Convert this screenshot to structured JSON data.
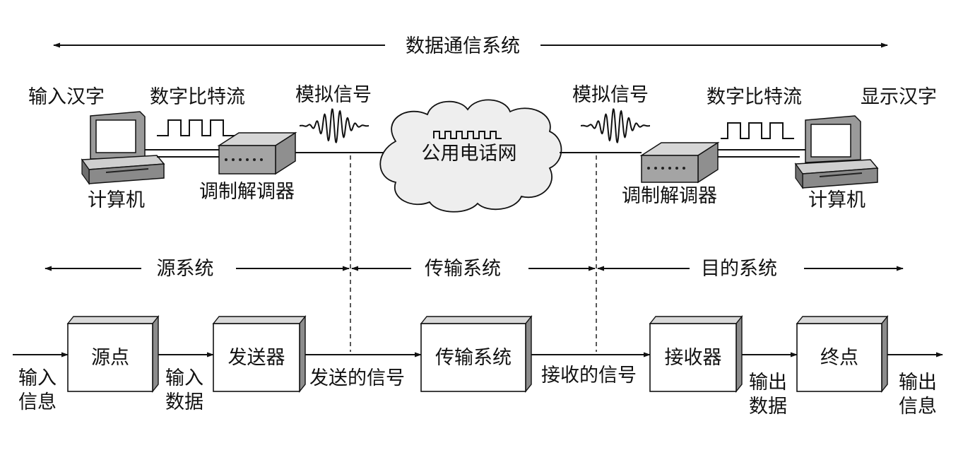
{
  "title": "数据通信系统",
  "top": {
    "left_input": "输入汉字",
    "left_bits": "数字比特流",
    "left_analog": "模拟信号",
    "left_computer": "计算机",
    "left_modem": "调制解调器",
    "network": "公用电话网",
    "right_analog": "模拟信号",
    "right_bits": "数字比特流",
    "right_display": "显示汉字",
    "right_computer": "计算机",
    "right_modem": "调制解调器"
  },
  "sections": {
    "source": "源系统",
    "transmission": "传输系统",
    "destination": "目的系统"
  },
  "boxes": {
    "source": "源点",
    "transmitter": "发送器",
    "transmission": "传输系统",
    "receiver": "接收器",
    "destination": "终点"
  },
  "labels": {
    "input_info_1": "输入",
    "input_info_2": "信息",
    "input_data_1": "输入",
    "input_data_2": "数据",
    "sent_signal": "发送的信号",
    "received_signal": "接收的信号",
    "output_data_1": "输出",
    "output_data_2": "数据",
    "output_info_1": "输出",
    "output_info_2": "信息"
  }
}
